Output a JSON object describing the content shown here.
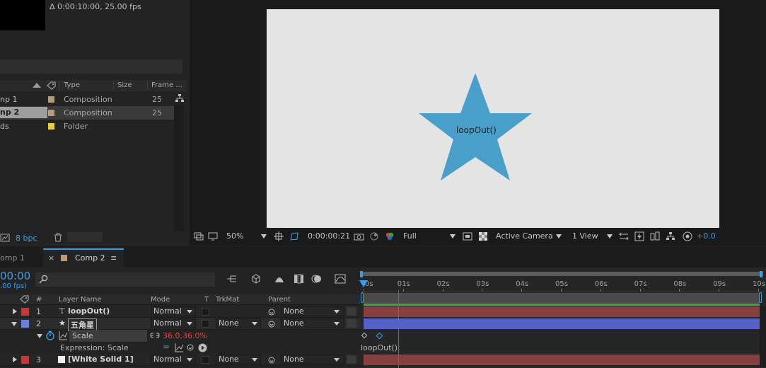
{
  "project": {
    "info_line1": "Δ 0:00:10:00, 25.00 fps",
    "columns": {
      "type": "Type",
      "size": "Size",
      "frame": "Frame ..."
    },
    "items": [
      {
        "name": "np 1",
        "type": "Composition",
        "frame": "25",
        "color": "#b39c7f",
        "selected": false
      },
      {
        "name": "np 2",
        "type": "Composition",
        "frame": "25",
        "color": "#b39c7f",
        "selected": true
      },
      {
        "name": "ds",
        "type": "Folder",
        "frame": "",
        "color": "#e6cf47",
        "selected": false
      }
    ],
    "bpc": "8 bpc"
  },
  "viewer": {
    "star_text": "loopOut()",
    "zoom": "50%",
    "timecode": "0:00:00:21",
    "resolution": "Full",
    "camera": "Active Camera",
    "views": "1 View",
    "exposure": "+0.0",
    "canvas_color": "#e4e4e4",
    "star_color": "#4a9fca"
  },
  "timeline": {
    "tab_inactive": "omp 1",
    "tab_active": "Comp 2",
    "time": "00:00",
    "fps": ".00 fps)",
    "search_placeholder": "",
    "headers": {
      "num": "#",
      "layer_name": "Layer Name",
      "mode": "Mode",
      "t": "T",
      "trkmat": "TrkMat",
      "parent": "Parent"
    },
    "layers": [
      {
        "num": "1",
        "name": "loopOut()",
        "mode": "Normal",
        "trkmat": "",
        "parent": "None",
        "color": "#c43a3a",
        "expanded": false
      },
      {
        "num": "2",
        "name": "五角星",
        "mode": "Normal",
        "trkmat": "None",
        "parent": "None",
        "color": "#6c7fdb",
        "expanded": true
      },
      {
        "num": "3",
        "name": "[White Solid 1]",
        "mode": "Normal",
        "trkmat": "None",
        "parent": "None",
        "color": "#c43a3a",
        "expanded": false
      }
    ],
    "property": {
      "name": "Scale",
      "value": "36.0,36.0%"
    },
    "expression_label": "Expression: Scale",
    "expression_text": "loopOut();",
    "ruler": [
      "0s",
      "01s",
      "02s",
      "03s",
      "04s",
      "05s",
      "06s",
      "07s",
      "08s",
      "09s",
      "10s"
    ]
  }
}
